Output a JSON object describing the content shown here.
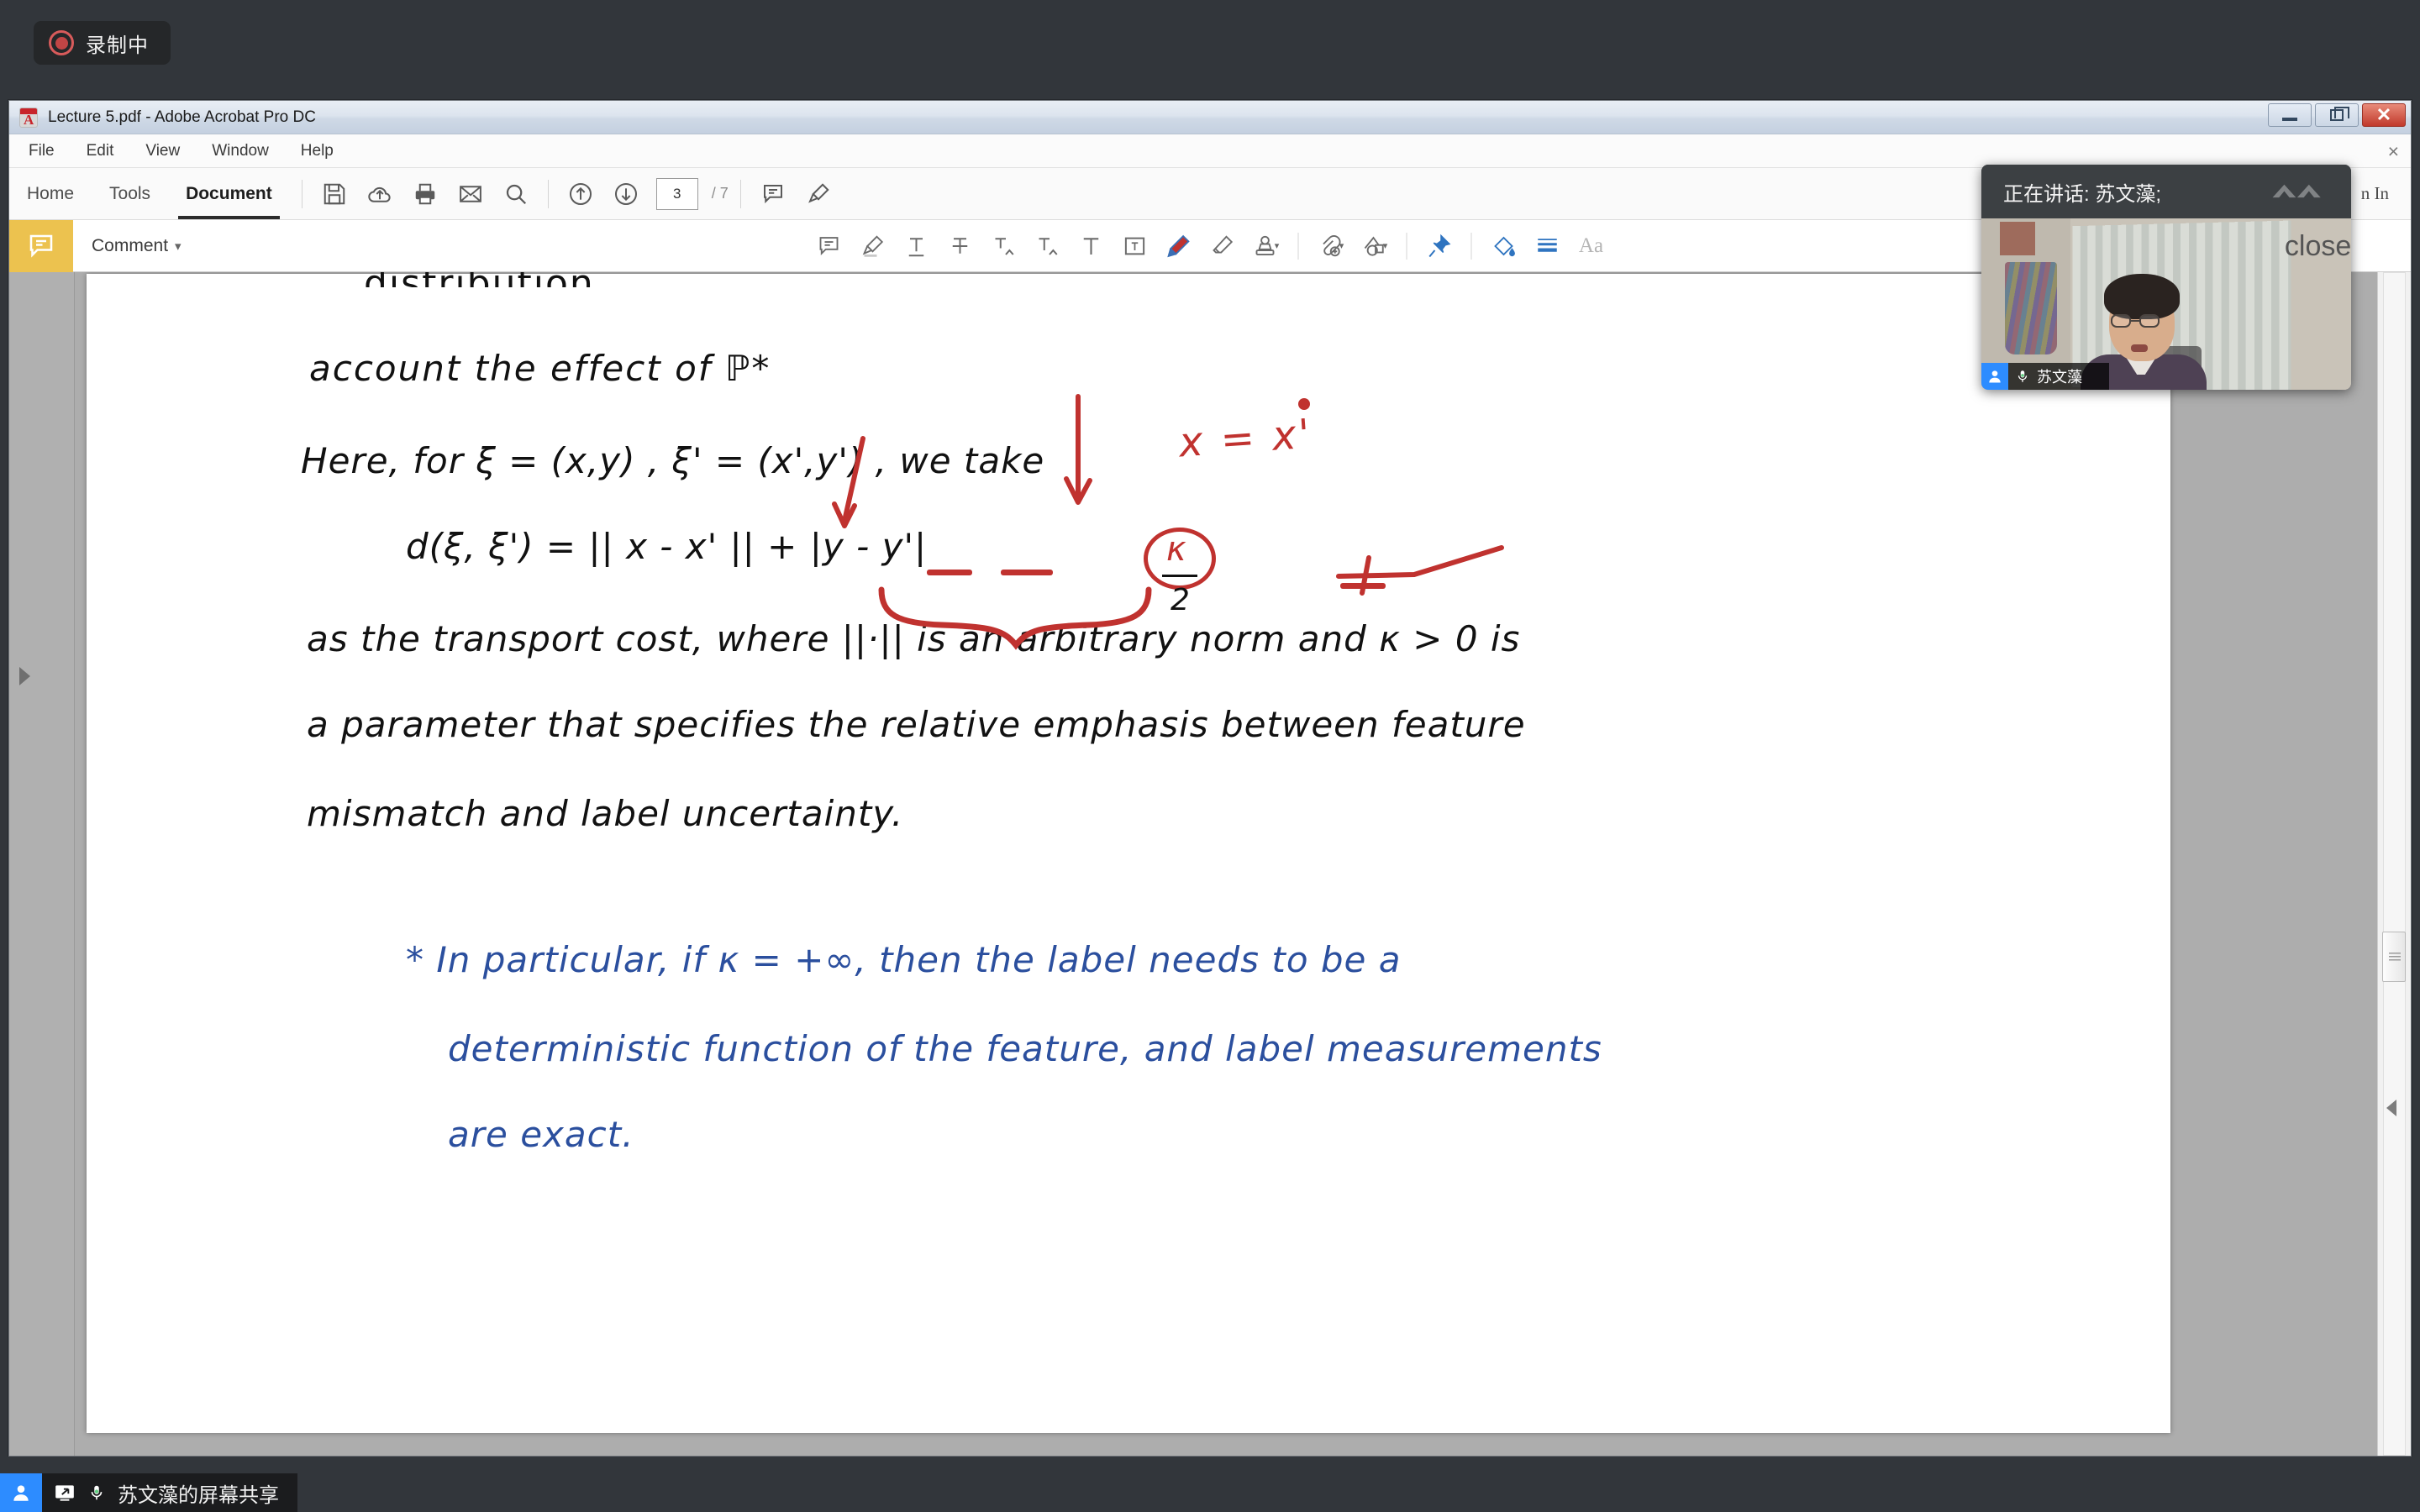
{
  "zoom_shell": {
    "recording_label": "录制中",
    "recording_icon": "record-dot-icon"
  },
  "acrobat": {
    "title": "Lecture 5.pdf - Adobe Acrobat Pro DC",
    "app_icon": "adobe-acrobat-icon",
    "window_controls": {
      "minimize": "minimize-icon",
      "restore": "restore-icon",
      "close": "close-icon"
    },
    "menus": [
      "File",
      "Edit",
      "View",
      "Window",
      "Help"
    ],
    "menubar_close": "×",
    "tabs": [
      {
        "label": "Home",
        "active": false
      },
      {
        "label": "Tools",
        "active": false
      },
      {
        "label": "Document",
        "active": true
      }
    ],
    "toolbar_icons": [
      "save-icon",
      "upload-to-cloud-icon",
      "print-icon",
      "email-icon",
      "search-icon"
    ],
    "page_nav": {
      "previous_page_icon": "arrow-up-circle-icon",
      "next_page_icon": "arrow-down-circle-icon",
      "current_page": "3",
      "page_total": "/ 7"
    },
    "right_toolbar_icons": [
      "comment-icon",
      "highlight-icon"
    ],
    "sign_in_label": "n In",
    "comment_panel": {
      "chip_icon": "comment-bubble-icon",
      "label": "Comment",
      "caret": "▾"
    },
    "annotation_tools": [
      {
        "name": "sticky-note-icon",
        "caret": false
      },
      {
        "name": "highlight-text-icon",
        "caret": false
      },
      {
        "name": "underline-text-icon",
        "caret": false
      },
      {
        "name": "strikethrough-text-icon",
        "caret": false
      },
      {
        "name": "insert-text-icon",
        "caret": false
      },
      {
        "name": "replace-text-icon",
        "caret": false
      },
      {
        "name": "add-text-icon",
        "caret": false
      },
      {
        "name": "text-box-icon",
        "caret": false
      },
      {
        "name": "draw-pencil-icon",
        "caret": false
      },
      {
        "name": "eraser-icon",
        "caret": false
      },
      {
        "name": "stamp-icon",
        "caret": true
      },
      {
        "name": "attach-file-icon",
        "caret": true
      },
      {
        "name": "add-shape-icon",
        "caret": true
      },
      {
        "name": "pin-icon",
        "caret": false
      },
      {
        "name": "fill-color-icon",
        "caret": false
      },
      {
        "name": "line-thickness-icon",
        "caret": false
      },
      {
        "name": "text-format-icon",
        "caret": false,
        "label": "Aa"
      }
    ],
    "scrollbar": {
      "thumb": "scrollbar-thumb",
      "collapse_icon": "collapse-panel-arrow-icon"
    },
    "nav_rail_icon": "expand-panel-arrow-icon"
  },
  "document": {
    "handwriting_black": [
      "account  the  effect  of  ℙ*",
      "Here,  for  ξ = (x,y) ,  ξ' = (x',y') ,  we  take",
      "d(ξ, ξ')  =   || x - x' ||  +     |y - y'|",
      "as  the  transport  cost,  where  ||·||  is  an  arbitrary  norm  and  κ > 0  is",
      "a  parameter  that  specifies  the  relative  emphasis  between  feature",
      "mismatch  and  label  uncertainty."
    ],
    "handwriting_blue": [
      "*  In  particular,  if  κ = +∞,  then  the  label  needs  to  be  a",
      "deterministic  function  of  the  feature,  and  label  measurements",
      "are  exact."
    ],
    "red_annotations": {
      "x_equals_x_prime": "x = x'",
      "kappa_circled": "κ",
      "fraction_denominator": "2",
      "tick_mark": "t"
    },
    "clipped_top_line": "distribution"
  },
  "zoom_video": {
    "speaking_label": "正在讲话: 苏文藻;",
    "participant_name": "苏文藻",
    "avatar_icon": "person-icon",
    "mic_icon": "microphone-icon",
    "logo_icon": "zoom-logo-icon",
    "close_icon": "close-icon"
  },
  "bottom_bar": {
    "share_label": "苏文藻的屏幕共享",
    "avatar_icon": "person-icon",
    "screen_share_icon": "screen-share-icon",
    "mic_icon": "microphone-icon"
  },
  "colors": {
    "zoom_bg": "#32363b",
    "accent_blue": "#2d8cff",
    "comment_gold": "#ecc24f",
    "ink_blue": "#2b4f9e",
    "ink_red": "#c0322f",
    "close_red": "#c1392b"
  }
}
